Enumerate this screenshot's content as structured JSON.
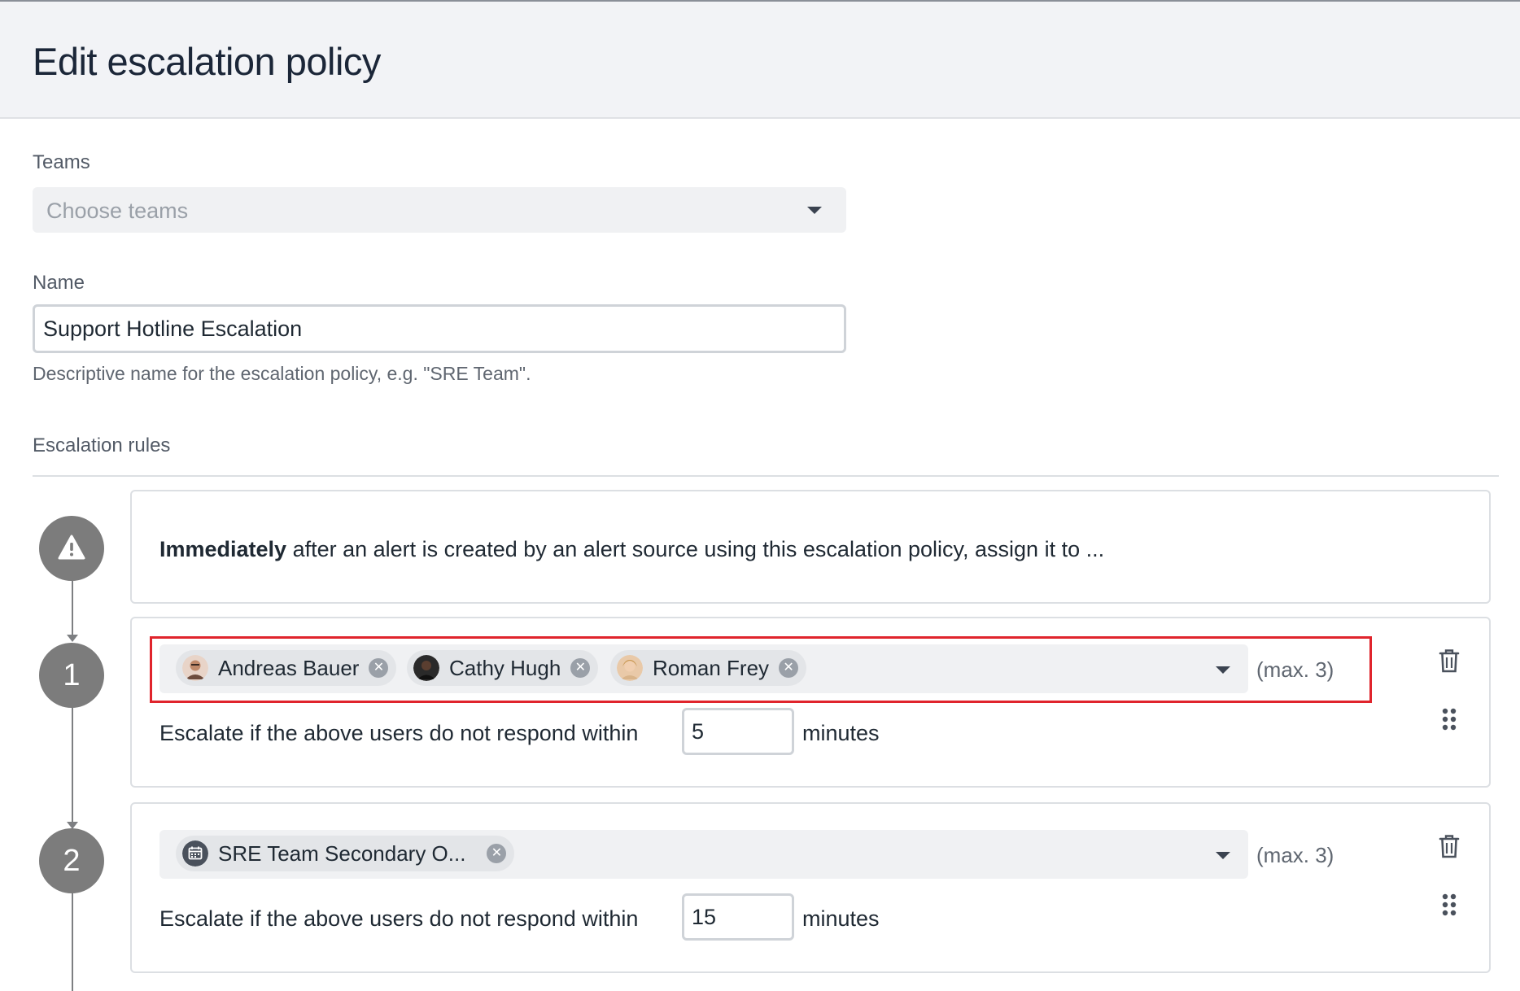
{
  "header": {
    "title": "Edit escalation policy"
  },
  "teams": {
    "label": "Teams",
    "placeholder": "Choose teams"
  },
  "name": {
    "label": "Name",
    "value": "Support Hotline Escalation",
    "hint": "Descriptive name for the escalation policy, e.g. \"SRE Team\"."
  },
  "escalation_rules": {
    "label": "Escalation rules",
    "intro": {
      "strong": "Immediately",
      "text": " after an alert is created by an alert source using this escalation policy, assign it to ..."
    },
    "rules": [
      {
        "number": "1",
        "assignees": [
          {
            "name": "Andreas Bauer",
            "avatar_color": "#b86f52"
          },
          {
            "name": "Cathy Hugh",
            "avatar_color": "#1e1e1e"
          },
          {
            "name": "Roman Frey",
            "avatar_color": "#d8a878"
          }
        ],
        "max_label": "(max. 3)",
        "escalate_label": "Escalate if the above users do not respond within",
        "minutes": "5",
        "minutes_label": "minutes"
      },
      {
        "number": "2",
        "assignees": [
          {
            "name": "SRE Team Secondary O...",
            "icon": "calendar-icon"
          }
        ],
        "max_label": "(max. 3)",
        "escalate_label": "Escalate if the above users do not respond within",
        "minutes": "15",
        "minutes_label": "minutes"
      }
    ]
  },
  "colors": {
    "highlight": "#e0242c",
    "step_circle": "#7c7c7c",
    "title": "#1b2638"
  }
}
